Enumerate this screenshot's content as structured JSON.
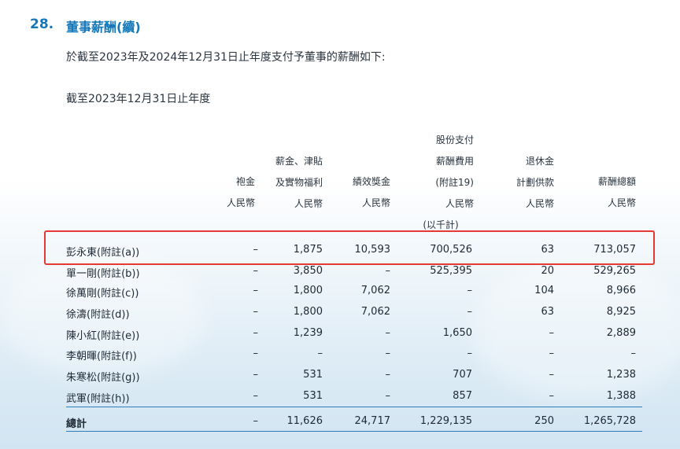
{
  "section": {
    "number": "28.",
    "title": "董事薪酬(續)",
    "intro": "於截至2023年及2024年12月31日止年度支付予董事的薪酬如下:",
    "subtitle": "截至2023年12月31日止年度"
  },
  "columns": [
    {
      "lines": [
        "袍金",
        "人民幣"
      ]
    },
    {
      "lines": [
        "薪金、津貼",
        "及實物福利",
        "人民幣"
      ]
    },
    {
      "lines": [
        "績效獎金",
        "人民幣"
      ]
    },
    {
      "lines": [
        "股份支付",
        "薪酬費用",
        "(附註19)",
        "人民幣",
        "(以千計)"
      ]
    },
    {
      "lines": [
        "退休金",
        "計劃供款",
        "人民幣"
      ]
    },
    {
      "lines": [
        "薪酬總額",
        "人民幣"
      ]
    }
  ],
  "rows": [
    {
      "name": "彭永東(附註(a))",
      "values": [
        "–",
        "1,875",
        "10,593",
        "700,526",
        "63",
        "713,057"
      ]
    },
    {
      "name": "單一剛(附註(b))",
      "values": [
        "–",
        "3,850",
        "–",
        "525,395",
        "20",
        "529,265"
      ]
    },
    {
      "name": "徐萬剛(附註(c))",
      "values": [
        "–",
        "1,800",
        "7,062",
        "–",
        "104",
        "8,966"
      ]
    },
    {
      "name": "徐濤(附註(d))",
      "values": [
        "–",
        "1,800",
        "7,062",
        "–",
        "63",
        "8,925"
      ]
    },
    {
      "name": "陳小紅(附註(e))",
      "values": [
        "–",
        "1,239",
        "–",
        "1,650",
        "–",
        "2,889"
      ]
    },
    {
      "name": "李朝暉(附註(f))",
      "values": [
        "–",
        "–",
        "–",
        "–",
        "–",
        "–"
      ]
    },
    {
      "name": "朱寒松(附註(g))",
      "values": [
        "–",
        "531",
        "–",
        "707",
        "–",
        "1,238"
      ]
    },
    {
      "name": "武軍(附註(h))",
      "values": [
        "–",
        "531",
        "–",
        "857",
        "–",
        "1,388"
      ]
    }
  ],
  "total": {
    "name": "總計",
    "values": [
      "–",
      "11,626",
      "24,717",
      "1,229,135",
      "250",
      "1,265,728"
    ]
  },
  "colors": {
    "accent": "#1478b8",
    "highlight": "#e53935"
  }
}
